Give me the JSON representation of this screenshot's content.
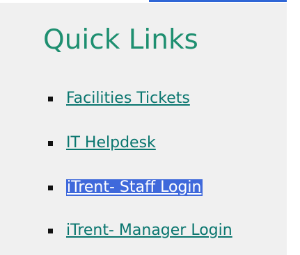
{
  "quick_links": {
    "title": "Quick Links",
    "items": [
      {
        "label": "Facilities Tickets",
        "selected": false
      },
      {
        "label": "IT Helpdesk",
        "selected": false
      },
      {
        "label": "iTrent- Staff Login",
        "selected": true
      },
      {
        "label": "iTrent- Manager Login",
        "selected": false
      }
    ]
  },
  "colors": {
    "heading": "#1e8f70",
    "link": "#0a766f",
    "selection_background": "#3f69db",
    "panel_background": "#f0f0f0",
    "top_accent": "#2f66d6"
  }
}
